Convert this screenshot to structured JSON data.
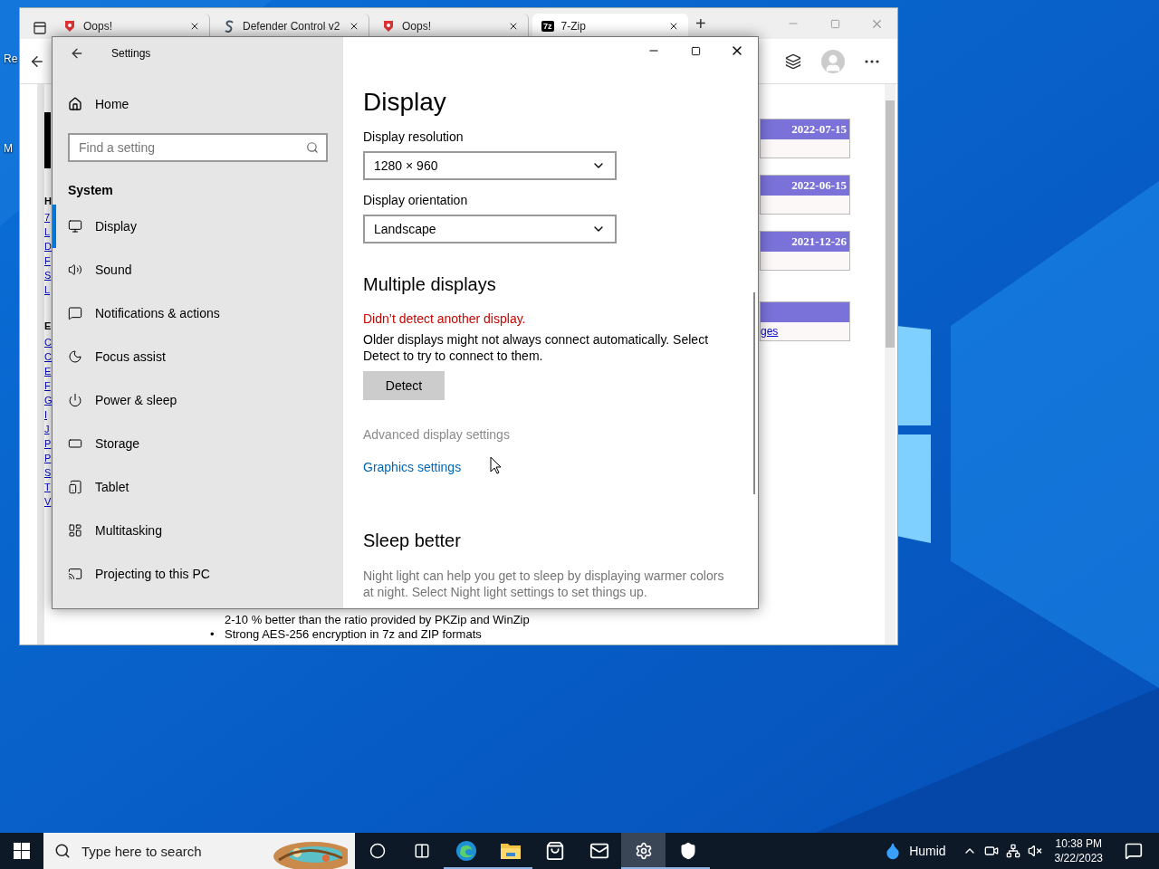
{
  "desktop": {
    "icons": [
      {
        "label": "Re"
      },
      {
        "label": "M"
      }
    ]
  },
  "browser": {
    "tabs": [
      {
        "kind": "error",
        "title": "Oops!",
        "selected": false
      },
      {
        "kind": "defender",
        "title": "Defender Control v2",
        "selected": false
      },
      {
        "kind": "error",
        "title": "Oops!",
        "selected": false
      },
      {
        "kind": "sevenzip",
        "favicon": "7z",
        "title": "7-Zip",
        "selected": true
      }
    ],
    "new_tab": "+",
    "sidebar_fragments": [
      {
        "kind": "heading",
        "text": "H"
      },
      {
        "kind": "link",
        "text": "7"
      },
      {
        "kind": "link",
        "text": "L"
      },
      {
        "kind": "link",
        "text": "D"
      },
      {
        "kind": "link",
        "text": "F"
      },
      {
        "kind": "link",
        "text": "S"
      },
      {
        "kind": "link",
        "text": "L"
      },
      {
        "kind": "heading",
        "text": "E"
      },
      {
        "kind": "link",
        "text": "C"
      },
      {
        "kind": "link",
        "text": "C"
      },
      {
        "kind": "link",
        "text": "E"
      },
      {
        "kind": "link",
        "text": "F"
      },
      {
        "kind": "link",
        "text": "G"
      },
      {
        "kind": "link",
        "text": "I"
      },
      {
        "kind": "link",
        "text": "J"
      },
      {
        "kind": "link",
        "text": "P"
      },
      {
        "kind": "link",
        "text": "P"
      },
      {
        "kind": "link",
        "text": "S"
      },
      {
        "kind": "link",
        "text": "T"
      },
      {
        "kind": "link",
        "text": "V"
      }
    ],
    "date_boxes": [
      {
        "date": "2022-07-15"
      },
      {
        "date": "2022-06-15"
      },
      {
        "date": "2021-12-26"
      },
      {
        "link": "ges"
      }
    ],
    "text_lines": [
      {
        "text": "2-10 % better than the ratio provided by PKZip and WinZip"
      },
      {
        "bullet": "•",
        "text": "Strong AES-256 encryption in 7z and ZIP formats"
      }
    ]
  },
  "settings": {
    "title": "Settings",
    "home": "Home",
    "search_placeholder": "Find a setting",
    "section": "System",
    "nav": [
      {
        "label": "Display",
        "selected": true
      },
      {
        "label": "Sound",
        "selected": false
      },
      {
        "label": "Notifications & actions",
        "selected": false
      },
      {
        "label": "Focus assist",
        "selected": false
      },
      {
        "label": "Power & sleep",
        "selected": false
      },
      {
        "label": "Storage",
        "selected": false
      },
      {
        "label": "Tablet",
        "selected": false
      },
      {
        "label": "Multitasking",
        "selected": false
      },
      {
        "label": "Projecting to this PC",
        "selected": false
      }
    ],
    "page": {
      "title": "Display",
      "fields": [
        {
          "label": "Display resolution",
          "value": "1280 × 960"
        },
        {
          "label": "Display orientation",
          "value": "Landscape"
        }
      ],
      "multiple": {
        "title": "Multiple displays",
        "error": "Didn’t detect another display.",
        "description": "Older displays might not always connect automatically. Select Detect to try to connect to them.",
        "button": "Detect"
      },
      "links": [
        {
          "text": "Advanced display settings",
          "disabled": true
        },
        {
          "text": "Graphics settings",
          "disabled": false
        }
      ],
      "sleep": {
        "title": "Sleep better",
        "description": "Night light can help you get to sleep by displaying warmer colors at night. Select Night light settings to set things up."
      }
    }
  },
  "taskbar": {
    "search_placeholder": "Type here to search",
    "apps": [
      {
        "running": false,
        "selected": false
      },
      {
        "running": false,
        "selected": false
      },
      {
        "running": true,
        "selected": false
      },
      {
        "running": true,
        "selected": false
      },
      {
        "running": false,
        "selected": false
      },
      {
        "running": false,
        "selected": false
      },
      {
        "running": true,
        "selected": true
      },
      {
        "running": true,
        "selected": false
      }
    ],
    "weather": "Humid",
    "time": "10:38 PM",
    "date": "3/22/2023"
  }
}
